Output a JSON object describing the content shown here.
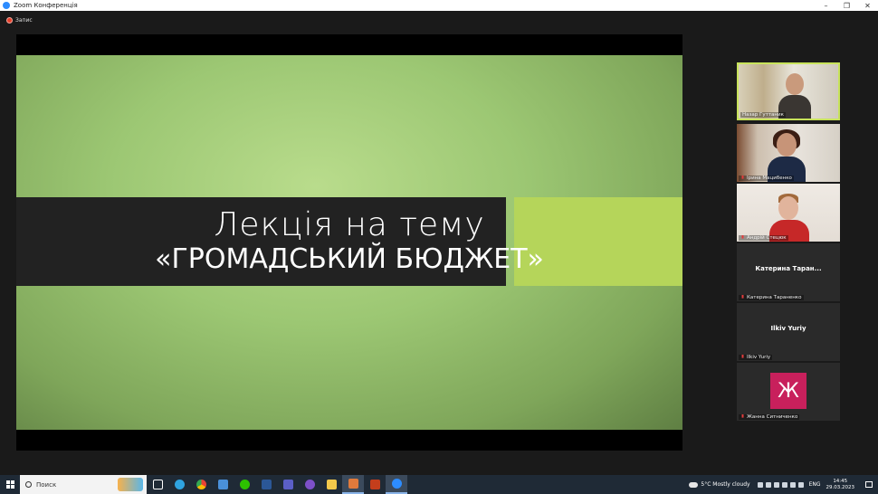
{
  "window": {
    "title": "Zoom Конференція"
  },
  "recording": {
    "label": "Запис"
  },
  "slide": {
    "line1": "Лекція на тему",
    "line2": "«ГРОМАДСЬКИЙ БЮДЖЕТ»"
  },
  "participants": [
    {
      "name": "Назар Гуттаник",
      "video": true
    },
    {
      "name": "Ірина Мацибенко",
      "video": true
    },
    {
      "name": "Андрій Стецюк",
      "video": true
    },
    {
      "name": "Катерина Тараненко",
      "display_name": "Катерина Таран...",
      "video": false
    },
    {
      "name": "Ilkiv Yuriy",
      "display_name": "Ilkiv Yuriy",
      "video": false
    },
    {
      "name": "Жанна Ситниченко",
      "avatar_letter": "Ж",
      "video": false
    }
  ],
  "taskbar": {
    "search_placeholder": "Поиск",
    "weather": "5°C  Mostly cloudy",
    "language": "ENG",
    "time": "14:45",
    "date": "29.03.2023"
  },
  "colors": {
    "accent_border": "#c8e35b",
    "avatar_bg": "#c8205c",
    "slide_green": "#9cc773"
  }
}
